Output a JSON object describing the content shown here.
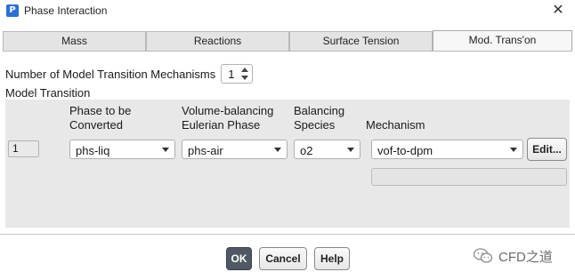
{
  "window": {
    "title": "Phase Interaction",
    "icon_letter": "P",
    "close_glyph": "✕"
  },
  "tabs": [
    {
      "label": "Mass",
      "active": false
    },
    {
      "label": "Reactions",
      "active": false
    },
    {
      "label": "Surface Tension",
      "active": false
    },
    {
      "label": "Mod. Trans'on",
      "active": true
    }
  ],
  "mechanisms": {
    "label": "Number of Model Transition Mechanisms",
    "value": "1"
  },
  "section_title": "Model Transition",
  "columns": {
    "phase_line1": "Phase to be",
    "phase_line2": "Converted",
    "vol_line1": "Volume-balancing",
    "vol_line2": "Eulerian Phase",
    "bal_line1": "Balancing",
    "bal_line2": "Species",
    "mechanism": "Mechanism"
  },
  "row": {
    "index": "1",
    "phase": "phs-liq",
    "vol_phase": "phs-air",
    "species": "o2",
    "mechanism": "vof-to-dpm",
    "edit_label": "Edit..."
  },
  "footer": {
    "ok": "OK",
    "cancel": "Cancel",
    "help": "Help"
  },
  "watermark": "CFD之道",
  "colors": {
    "accent": "#2a6fd6",
    "ok_button": "#4f5863",
    "panel": "#e8e8e8"
  }
}
